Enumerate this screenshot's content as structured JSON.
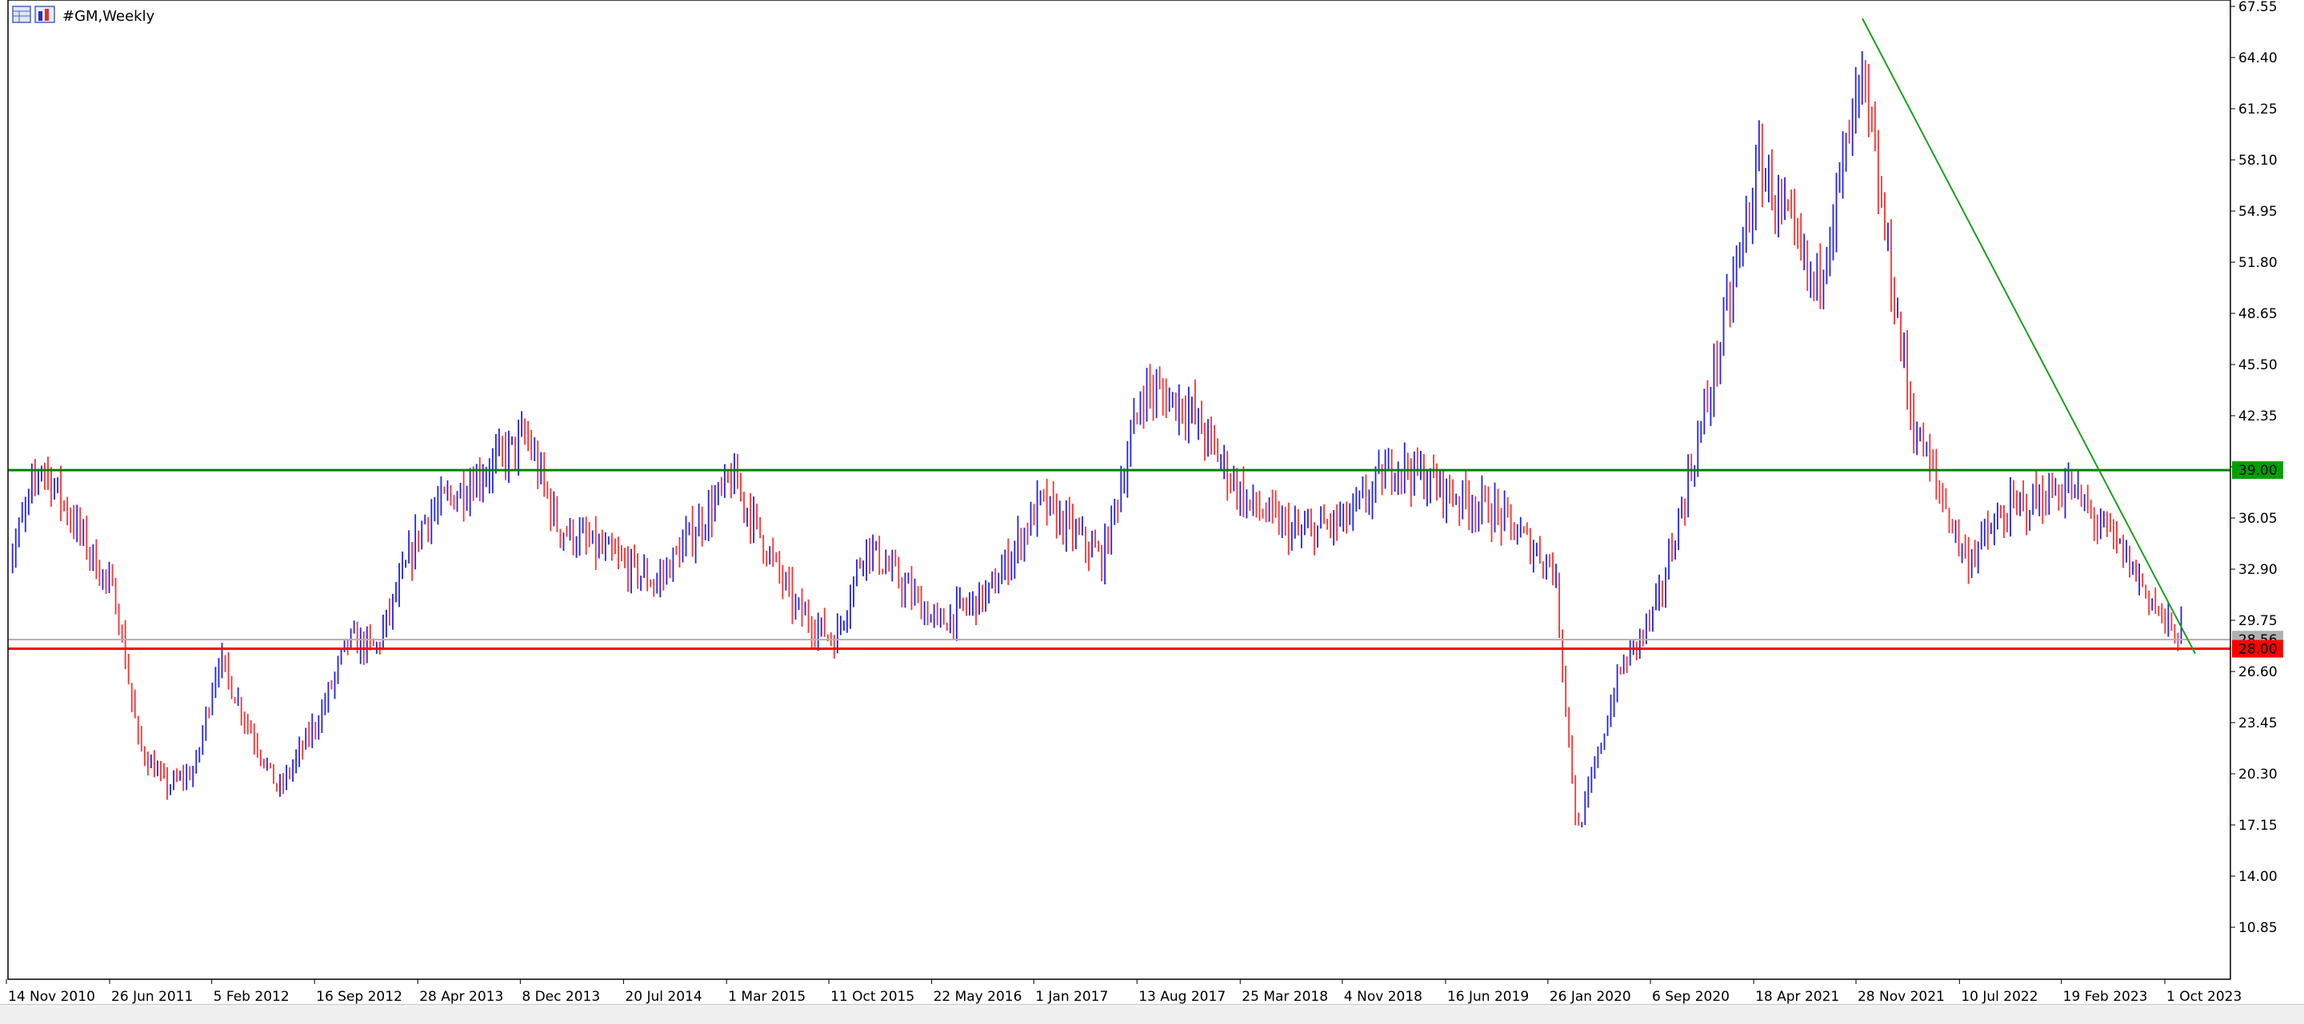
{
  "window": {
    "symbol_title": "#GM,Weekly"
  },
  "colors": {
    "up_bar": "#2020ff",
    "down_bar": "#ff3030",
    "support_line": "#ff0000",
    "resistance_line": "#008000",
    "trend_line": "#1e9e1e",
    "current_price_line": "#b0b0b0",
    "resistance_label_bg": "#00a000",
    "support_label_bg": "#ff0000"
  },
  "chart_data": {
    "type": "line",
    "title": "#GM,Weekly",
    "xlabel": "",
    "ylabel": "",
    "ylim": [
      7.7,
      67.55
    ],
    "y_ticks": [
      "67.55",
      "64.40",
      "61.25",
      "58.10",
      "54.95",
      "51.80",
      "48.65",
      "45.50",
      "42.35",
      "39.20",
      "36.05",
      "32.90",
      "29.75",
      "26.60",
      "23.45",
      "20.30",
      "17.15",
      "14.00",
      "10.85"
    ],
    "x_tick_labels": [
      "14 Nov 2010",
      "26 Jun 2011",
      "5 Feb 2012",
      "16 Sep 2012",
      "28 Apr 2013",
      "8 Dec 2013",
      "20 Jul 2014",
      "1 Mar 2015",
      "11 Oct 2015",
      "22 May 2016",
      "1 Jan 2017",
      "13 Aug 2017",
      "25 Mar 2018",
      "4 Nov 2018",
      "16 Jun 2019",
      "26 Jan 2020",
      "6 Sep 2020",
      "18 Apr 2021",
      "28 Nov 2021",
      "10 Jul 2022",
      "19 Feb 2023",
      "1 Oct 2023"
    ],
    "series": [
      {
        "points": [
          [
            "14 Nov 2010",
            34.0
          ],
          [
            "Jan 2011",
            39.5
          ],
          [
            "26 Jun 2011",
            31.0
          ],
          [
            "Aug 2011",
            22.0
          ],
          [
            "Oct 2011",
            19.5
          ],
          [
            "Dec 2011",
            20.5
          ],
          [
            "5 Feb 2012",
            27.5
          ],
          [
            "Apr 2012",
            23.0
          ],
          [
            "Jun 2012",
            19.2
          ],
          [
            "16 Sep 2012",
            24.0
          ],
          [
            "Nov 2012",
            28.5
          ],
          [
            "Jan 2013",
            28.0
          ],
          [
            "28 Apr 2013",
            36.0
          ],
          [
            "8 Dec 2013",
            41.0
          ],
          [
            "Feb 2014",
            35.5
          ],
          [
            "20 Jul 2014",
            33.0
          ],
          [
            "Sep 2014",
            32.0
          ],
          [
            "1 Mar 2015",
            38.5
          ],
          [
            "Jul 2015",
            30.5
          ],
          [
            "11 Oct 2015",
            28.5
          ],
          [
            "Dec 2015",
            34.5
          ],
          [
            "22 May 2016",
            29.5
          ],
          [
            "Sep 2016",
            31.5
          ],
          [
            "1 Jan 2017",
            37.0
          ],
          [
            "May 2017",
            33.5
          ],
          [
            "13 Aug 2017",
            44.0
          ],
          [
            "Nov 2017",
            43.0
          ],
          [
            "25 Mar 2018",
            37.0
          ],
          [
            "Jul 2018",
            35.0
          ],
          [
            "4 Nov 2018",
            36.0
          ],
          [
            "Feb 2019",
            39.5
          ],
          [
            "16 Jun 2019",
            37.5
          ],
          [
            "Sep 2019",
            36.5
          ],
          [
            "26 Jan 2020",
            33.0
          ],
          [
            "Mar 2020",
            16.5
          ],
          [
            "Jun 2020",
            26.5
          ],
          [
            "6 Sep 2020",
            30.5
          ],
          [
            "Dec 2020",
            42.0
          ],
          [
            "18 Apr 2021",
            58.0
          ],
          [
            "Aug 2021",
            50.0
          ],
          [
            "28 Nov 2021",
            63.0
          ],
          [
            "Mar 2022",
            42.0
          ],
          [
            "10 Jul 2022",
            33.5
          ],
          [
            "Oct 2022",
            36.5
          ],
          [
            "19 Feb 2023",
            38.0
          ],
          [
            "Jun 2023",
            34.0
          ],
          [
            "1 Oct 2023",
            29.0
          ]
        ]
      }
    ],
    "levels": [
      {
        "label": "39.00",
        "value": 39.0
      },
      {
        "label": "28.00",
        "value": 28.0
      }
    ],
    "current_price": {
      "label": "28.56",
      "value": 28.56
    },
    "trend_line": {
      "from": [
        "28 Nov 2021",
        66.8
      ],
      "to": [
        "1 Oct 2023",
        27.7
      ]
    },
    "grid": false,
    "legend": "none"
  }
}
